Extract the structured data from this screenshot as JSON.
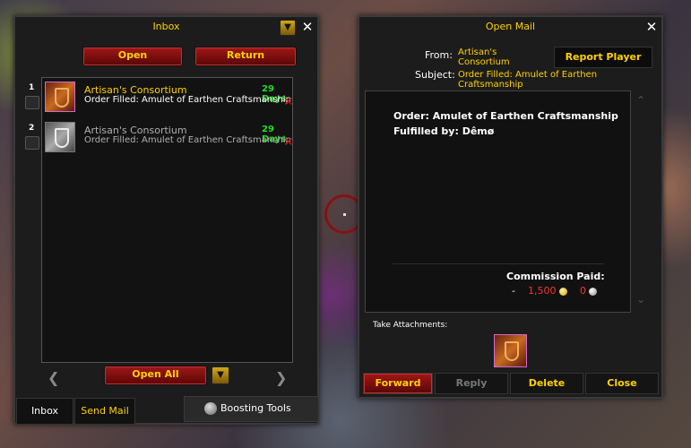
{
  "inbox": {
    "title": "Inbox",
    "open_label": "Open",
    "return_label": "Return",
    "items": [
      {
        "number": "1",
        "sender": "Artisan's Consortium",
        "days": "29 Days",
        "subject": "Order Filled: Amulet of Earthen Craftsmanship"
      },
      {
        "number": "2",
        "sender": "Artisan's Consortium",
        "days": "29 Days",
        "subject": "Order Filled: Amulet of Earthen Craftsmanship"
      }
    ],
    "open_all_label": "Open All",
    "tabs": {
      "inbox": "Inbox",
      "send_mail": "Send Mail"
    },
    "boosting_tools_label": "Boosting Tools"
  },
  "open_mail": {
    "title": "Open Mail",
    "from_label": "From:",
    "from_value": "Artisan's Consortium",
    "report_label": "Report Player",
    "subject_label": "Subject:",
    "subject_value": "Order Filled: Amulet of Earthen Craftsmanship",
    "body_line1": "Order: Amulet of Earthen Craftsmanship",
    "body_line2": "Fulfilled by: Dêmø",
    "commission_label": "Commission Paid:",
    "commission_dash": "-",
    "commission_gold": "1,500",
    "commission_silver": "0",
    "attachments_label": "Take Attachments:",
    "buttons": {
      "forward": "Forward",
      "reply": "Reply",
      "delete": "Delete",
      "close": "Close"
    }
  },
  "colors": {
    "gold_text": "#ffd100",
    "days_green": "#22dd22",
    "red_button": "#a01818"
  }
}
